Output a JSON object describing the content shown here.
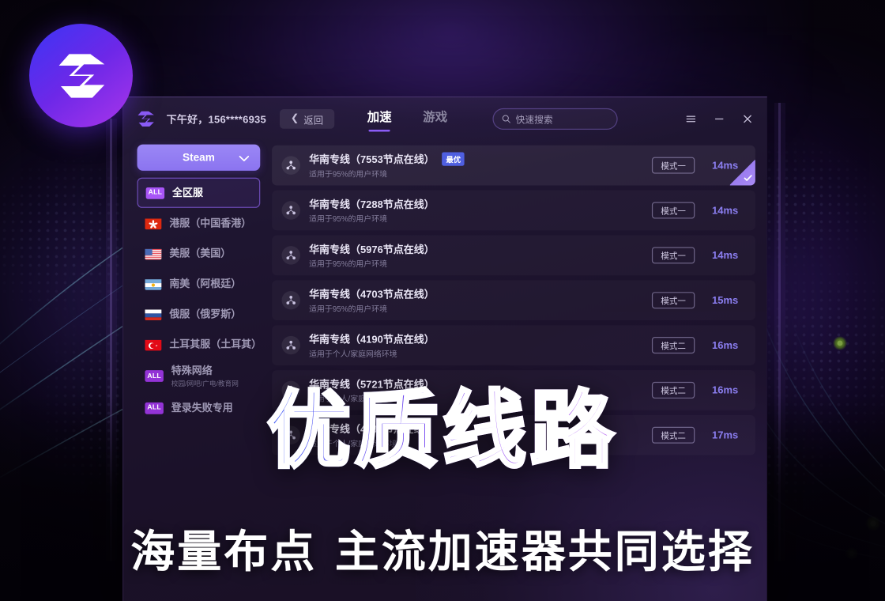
{
  "window": {
    "greeting": "下午好，156****6935",
    "back_label": "返回",
    "back_icon": "chevron-left-icon",
    "logo_icon": "app-logo-icon",
    "tabs": [
      {
        "label": "加速",
        "active": true
      },
      {
        "label": "游戏",
        "active": false
      }
    ],
    "search": {
      "placeholder": "快速搜索",
      "icon": "search-icon",
      "value": ""
    },
    "controls": [
      {
        "name": "menu-icon",
        "glyph": "☰"
      },
      {
        "name": "minimize-icon",
        "glyph": "−"
      },
      {
        "name": "close-icon",
        "glyph": "✕"
      }
    ]
  },
  "sidebar": {
    "game_selector": {
      "label": "Steam",
      "chevron": "chevron-down-icon"
    },
    "regions": [
      {
        "name": "全区服",
        "sub": "",
        "icon": "badge-all",
        "badge_text": "ALL",
        "active": true
      },
      {
        "name": "港服（中国香港）",
        "sub": "",
        "icon": "flag-hk",
        "active": false
      },
      {
        "name": "美服（美国）",
        "sub": "",
        "icon": "flag-us",
        "active": false
      },
      {
        "name": "南美（阿根廷）",
        "sub": "",
        "icon": "flag-ar",
        "active": false
      },
      {
        "name": "俄服（俄罗斯）",
        "sub": "",
        "icon": "flag-ru",
        "active": false
      },
      {
        "name": "土耳其服（土耳其）",
        "sub": "",
        "icon": "flag-tr",
        "active": false
      },
      {
        "name": "特殊网络",
        "sub": "校园/网吧/广电/教育网",
        "icon": "badge-all",
        "badge_text": "ALL",
        "active": false
      },
      {
        "name": "登录失败专用",
        "sub": "",
        "icon": "badge-all",
        "badge_text": "ALL",
        "active": false
      }
    ]
  },
  "servers": {
    "rows": [
      {
        "title": "华南专线（7553节点在线）",
        "sub": "适用于95%的用户环境",
        "badge": "最优",
        "mode": "模式一",
        "ping": "14ms",
        "selected": true
      },
      {
        "title": "华南专线（7288节点在线）",
        "sub": "适用于95%的用户环境",
        "badge": "",
        "mode": "模式一",
        "ping": "14ms",
        "selected": false
      },
      {
        "title": "华南专线（5976节点在线）",
        "sub": "适用于95%的用户环境",
        "badge": "",
        "mode": "模式一",
        "ping": "14ms",
        "selected": false
      },
      {
        "title": "华南专线（4703节点在线）",
        "sub": "适用于95%的用户环境",
        "badge": "",
        "mode": "模式一",
        "ping": "15ms",
        "selected": false
      },
      {
        "title": "华南专线（4190节点在线）",
        "sub": "适用于个人/家庭网络环境",
        "badge": "",
        "mode": "模式二",
        "ping": "16ms",
        "selected": false
      },
      {
        "title": "华南专线（5721节点在线）",
        "sub": "适用于个人/家庭网络环境",
        "badge": "",
        "mode": "模式二",
        "ping": "16ms",
        "selected": false
      },
      {
        "title": "华南专线（4982节点在线）",
        "sub": "适用于个人/家庭网络环境",
        "badge": "",
        "mode": "模式二",
        "ping": "17ms",
        "selected": false
      }
    ]
  },
  "overlay": {
    "headline": "优质线路",
    "subline": "海量布点 主流加速器共同选择",
    "logo_icon": "brand-ss-logo-icon"
  },
  "colors": {
    "accent_purple": "#8b5cf6",
    "accent_blue": "#4f5fe0",
    "ping_text": "#8b7ef0",
    "badge_all": "#9333d6",
    "window_bg": "#1e1530",
    "headline_gradient_start": "#3d5bf5",
    "headline_gradient_end": "#b964f2"
  }
}
